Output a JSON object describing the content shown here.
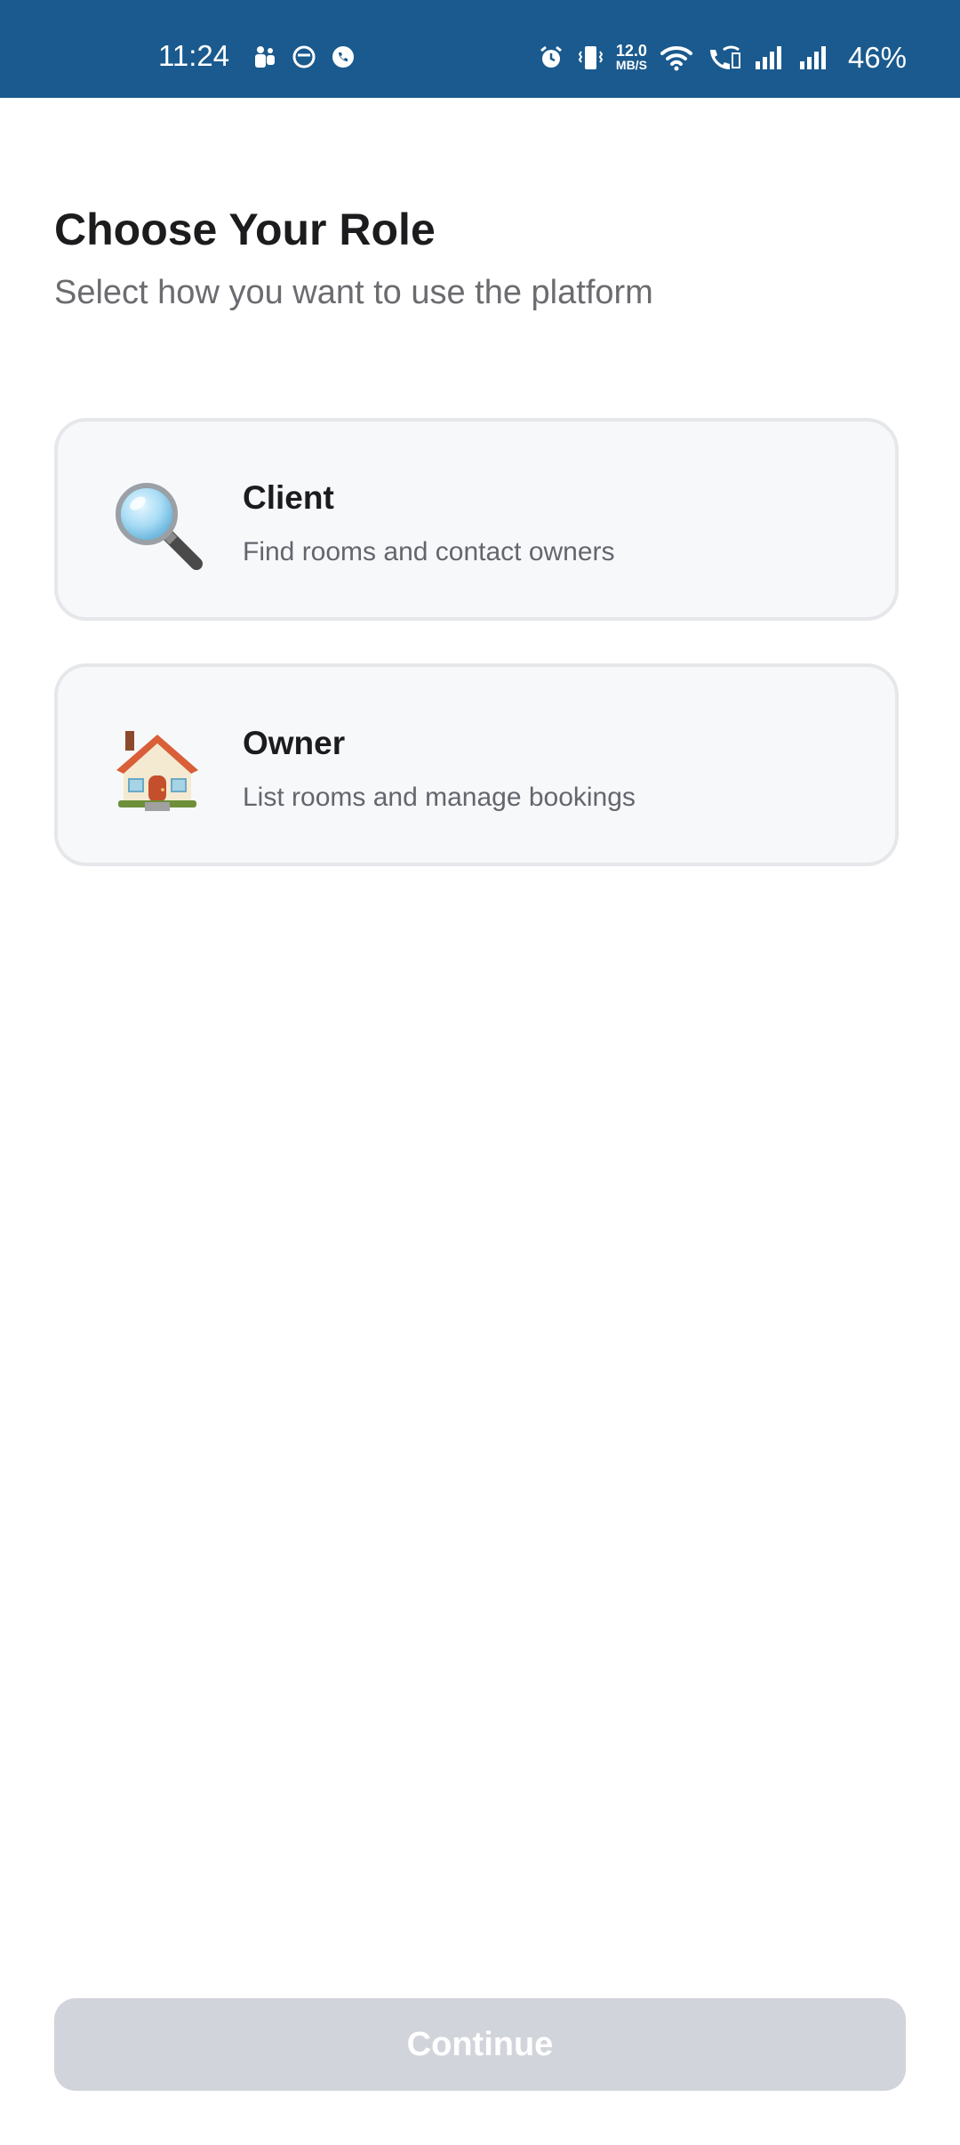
{
  "status_bar": {
    "time": "11:24",
    "speed_value": "12.0",
    "speed_unit": "MB/S",
    "battery": "46%",
    "background": "#1a5a8e",
    "icons": [
      "teams-icon",
      "circle-app-icon",
      "phone-app-icon",
      "alarm-icon",
      "vibrate-icon",
      "wifi-icon",
      "wifi-calling-icon",
      "signal-icon",
      "signal-icon"
    ]
  },
  "header": {
    "title": "Choose Your Role",
    "subtitle": "Select how you want to use the platform"
  },
  "roles": [
    {
      "title": "Client",
      "description": "Find rooms and contact owners",
      "icon": "magnifying-glass-icon"
    },
    {
      "title": "Owner",
      "description": "List rooms and manage bookings",
      "icon": "house-icon"
    }
  ],
  "footer": {
    "continue_label": "Continue",
    "continue_state": "disabled"
  }
}
